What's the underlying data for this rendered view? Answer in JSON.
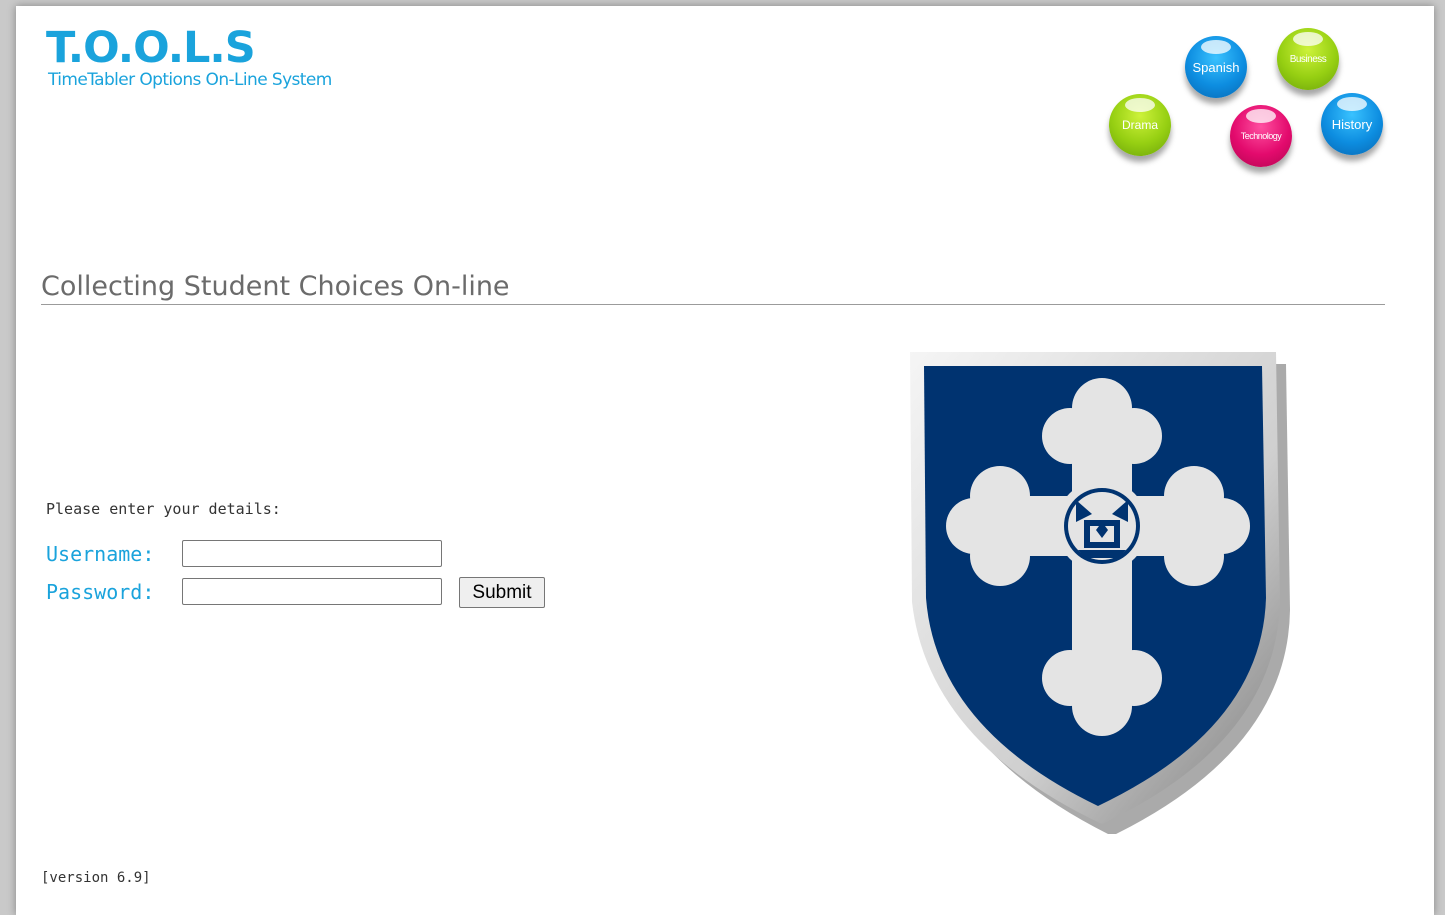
{
  "logo": {
    "title": "T.O.O.L.S",
    "subtitle": "TimeTabler Options On-Line System"
  },
  "subject_bubbles": [
    {
      "label": "Spanish",
      "color": "#0d8de0"
    },
    {
      "label": "Business",
      "color": "#96cf12"
    },
    {
      "label": "Drama",
      "color": "#96cf12"
    },
    {
      "label": "Technology",
      "color": "#e30a6d"
    },
    {
      "label": "History",
      "color": "#0d8de0"
    }
  ],
  "heading": "Collecting Student Choices On-line",
  "login": {
    "prompt": "Please enter your details:",
    "username_label": "Username:",
    "username_value": "",
    "password_label": "Password:",
    "password_value": "",
    "submit_label": "Submit"
  },
  "crest": {
    "icon": "school-crest-icon",
    "shield_color": "#003370",
    "cross_color": "#e4e4e4"
  },
  "version": "[version 6.9]",
  "colors": {
    "accent": "#1aa3dc",
    "heading_text": "#6b6b6b"
  }
}
